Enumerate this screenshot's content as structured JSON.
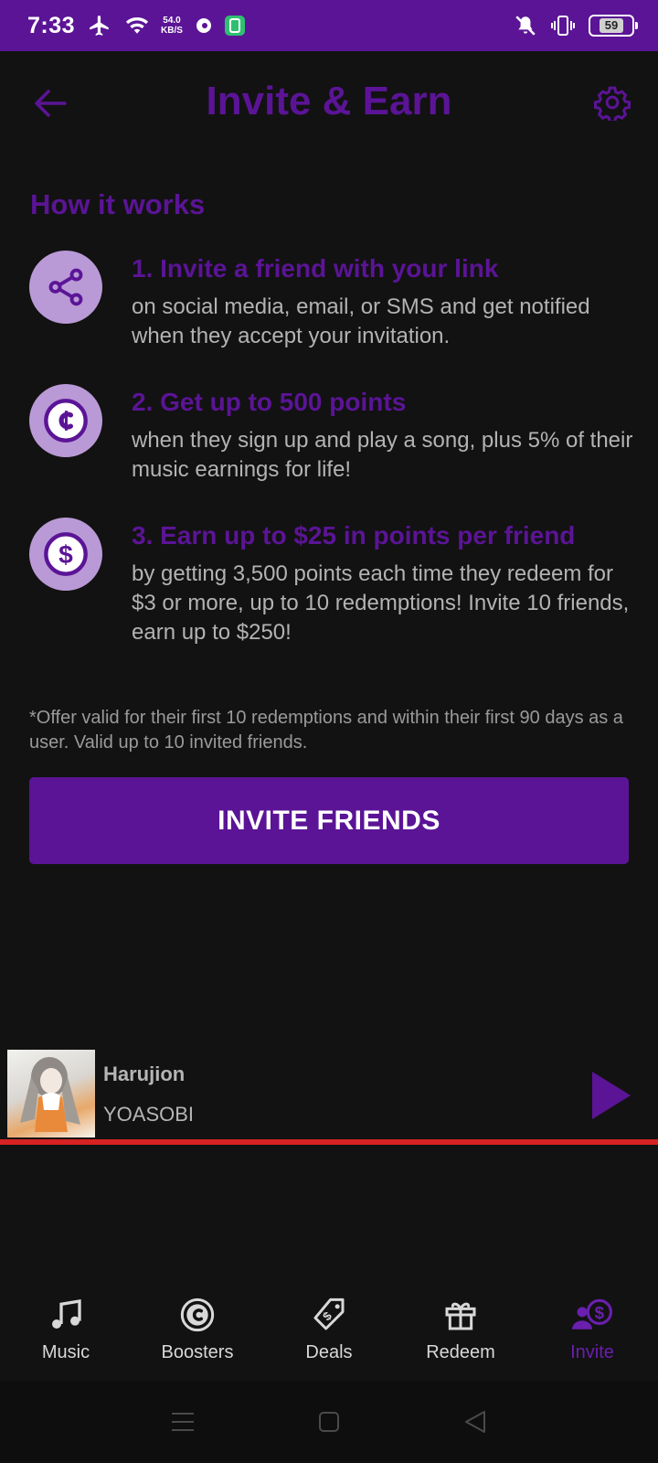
{
  "status_bar": {
    "time": "7:33",
    "net_speed_value": "54.0",
    "net_speed_unit": "KB/S",
    "battery": "59"
  },
  "header": {
    "title": "Invite & Earn"
  },
  "how_it_works": {
    "title": "How it works",
    "steps": [
      {
        "title": "1. Invite a friend with your link",
        "description": "on social media, email, or SMS and get notified when they accept your invitation.",
        "icon": "share-icon"
      },
      {
        "title": "2. Get up to 500 points",
        "description": "when they sign up and play a song, plus 5% of their music earnings for life!",
        "icon": "points-coin-icon"
      },
      {
        "title": "3. Earn up to $25 in points per friend",
        "description": "by getting 3,500 points each time they redeem for $3 or more, up to 10 redemptions! Invite 10 friends, earn up to $250!",
        "icon": "dollar-coin-icon"
      }
    ],
    "footnote": "*Offer valid for their first 10 redemptions and within their first 90 days as a user. Valid up to 10 invited friends."
  },
  "invite_button": "INVITE FRIENDS",
  "player": {
    "title": "Harujion",
    "artist": "YOASOBI",
    "progress": 1.0
  },
  "bottom_nav": {
    "items": [
      {
        "label": "Music",
        "icon": "music-note-icon",
        "active": false
      },
      {
        "label": "Boosters",
        "icon": "booster-coin-icon",
        "active": false
      },
      {
        "label": "Deals",
        "icon": "deal-tag-icon",
        "active": false
      },
      {
        "label": "Redeem",
        "icon": "gift-icon",
        "active": false
      },
      {
        "label": "Invite",
        "icon": "invite-user-dollar-icon",
        "active": true
      }
    ]
  },
  "colors": {
    "brand_purple": "#5b1496",
    "step_icon_bg": "#b99ad6",
    "progress_red": "#d62222",
    "background": "#121212"
  }
}
